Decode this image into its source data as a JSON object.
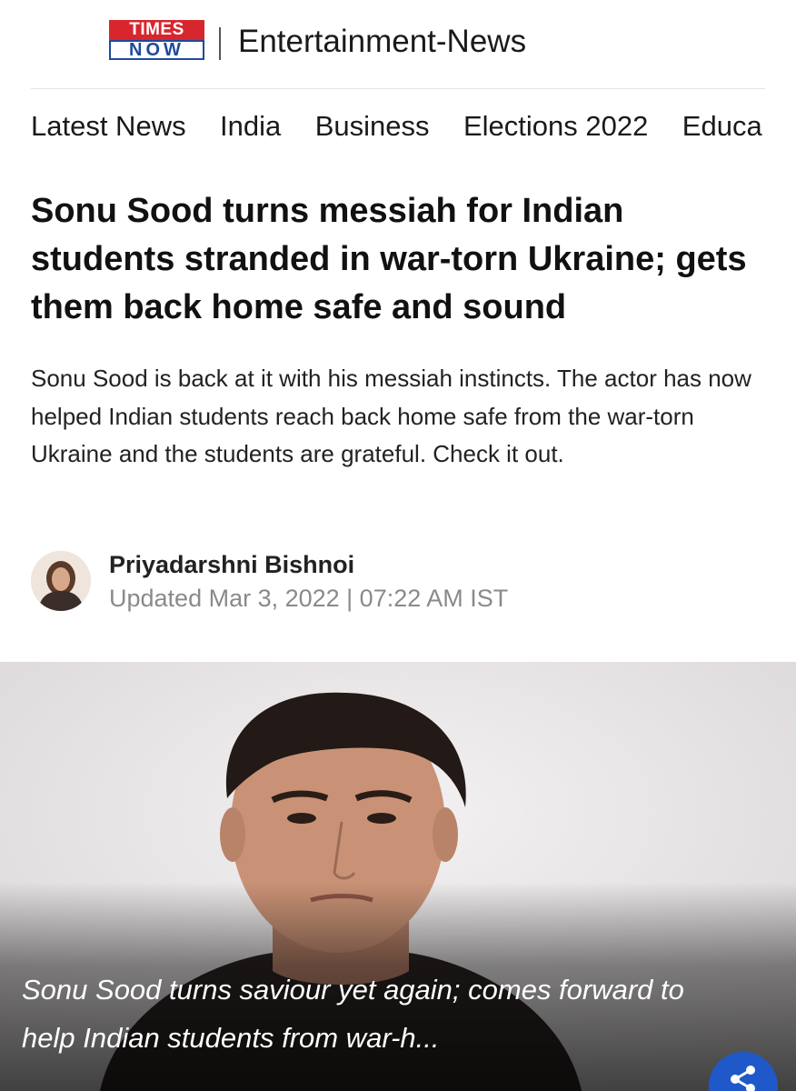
{
  "header": {
    "logo_top": "TIMES",
    "logo_bottom": "NOW",
    "section": "Entertainment-News"
  },
  "nav": {
    "items": [
      "Latest News",
      "India",
      "Business",
      "Elections 2022",
      "Educa"
    ]
  },
  "article": {
    "headline": "Sonu Sood turns messiah for Indian students stranded in war-torn Ukraine; gets them back home safe and sound",
    "summary": "Sonu Sood is back at it with his messiah instincts. The actor has now helped Indian students reach back home safe from the war-torn Ukraine and the students are grateful. Check it out.",
    "author": "Priyadarshni Bishnoi",
    "updated": "Updated Mar 3, 2022 | 07:22 AM IST",
    "image_caption": "Sonu Sood turns saviour yet again; comes forward to help Indian students from war-h..."
  },
  "colors": {
    "logo_red": "#d7262e",
    "logo_blue": "#1f4a9c",
    "share_blue": "#1f59c9",
    "meta_gray": "#8a8a8a"
  },
  "icons": {
    "share": "share-icon"
  }
}
